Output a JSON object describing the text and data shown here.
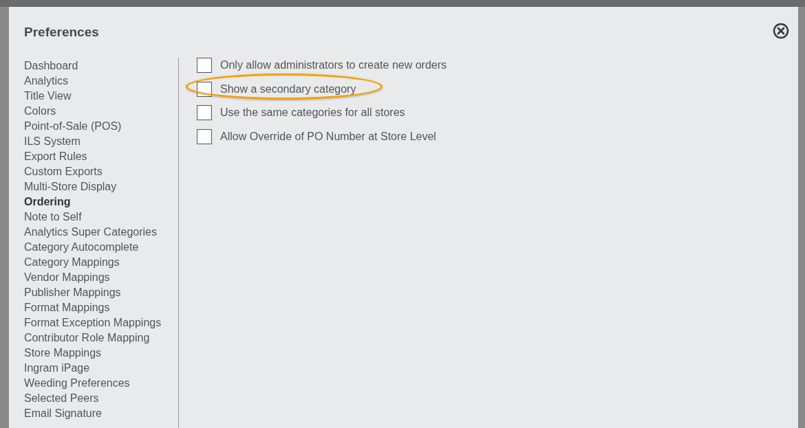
{
  "dialog": {
    "title": "Preferences"
  },
  "sidebar": {
    "items": [
      {
        "label": "Dashboard",
        "selected": false
      },
      {
        "label": "Analytics",
        "selected": false
      },
      {
        "label": "Title View",
        "selected": false
      },
      {
        "label": "Colors",
        "selected": false
      },
      {
        "label": "Point-of-Sale (POS)",
        "selected": false
      },
      {
        "label": "ILS System",
        "selected": false
      },
      {
        "label": "Export Rules",
        "selected": false
      },
      {
        "label": "Custom Exports",
        "selected": false
      },
      {
        "label": "Multi-Store Display",
        "selected": false
      },
      {
        "label": "Ordering",
        "selected": true
      },
      {
        "label": "Note to Self",
        "selected": false
      },
      {
        "label": "Analytics Super Categories",
        "selected": false
      },
      {
        "label": "Category Autocomplete",
        "selected": false
      },
      {
        "label": "Category Mappings",
        "selected": false
      },
      {
        "label": "Vendor Mappings",
        "selected": false
      },
      {
        "label": "Publisher Mappings",
        "selected": false
      },
      {
        "label": "Format Mappings",
        "selected": false
      },
      {
        "label": "Format Exception Mappings",
        "selected": false
      },
      {
        "label": "Contributor Role Mapping",
        "selected": false
      },
      {
        "label": "Store Mappings",
        "selected": false
      },
      {
        "label": "Ingram iPage",
        "selected": false
      },
      {
        "label": "Weeding Preferences",
        "selected": false
      },
      {
        "label": "Selected Peers",
        "selected": false
      },
      {
        "label": "Email Signature",
        "selected": false
      }
    ]
  },
  "options": [
    {
      "label": "Only allow administrators to create new orders",
      "checked": false,
      "highlighted": false
    },
    {
      "label": "Show a secondary category",
      "checked": false,
      "highlighted": true
    },
    {
      "label": "Use the same categories for all stores",
      "checked": false,
      "highlighted": false
    },
    {
      "label": "Allow Override of PO Number at Store Level",
      "checked": false,
      "highlighted": false
    }
  ]
}
